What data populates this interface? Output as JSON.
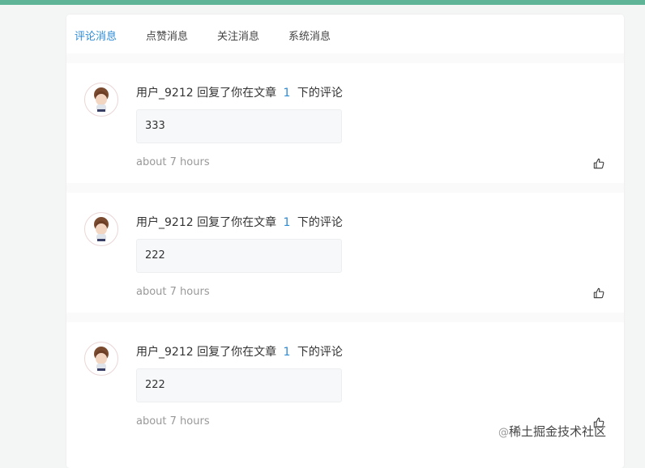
{
  "tabs": [
    {
      "label": "评论消息",
      "active": true
    },
    {
      "label": "点赞消息",
      "active": false
    },
    {
      "label": "关注消息",
      "active": false
    },
    {
      "label": "系统消息",
      "active": false
    }
  ],
  "messages": [
    {
      "user": "用户_9212",
      "action": "回复了你在文章",
      "article": "1",
      "suffix": "下的评论",
      "content": "333",
      "time": "about 7 hours"
    },
    {
      "user": "用户_9212",
      "action": "回复了你在文章",
      "article": "1",
      "suffix": "下的评论",
      "content": "222",
      "time": "about 7 hours"
    },
    {
      "user": "用户_9212",
      "action": "回复了你在文章",
      "article": "1",
      "suffix": "下的评论",
      "content": "222",
      "time": "about 7 hours"
    }
  ],
  "watermark": {
    "at": "@",
    "text": "稀土掘金技术社区"
  },
  "colors": {
    "accent": "#2d8cd8",
    "topbar": "#5fb397"
  },
  "icons": {
    "like": "thumbs-up-icon",
    "avatar": "avatar-image"
  }
}
